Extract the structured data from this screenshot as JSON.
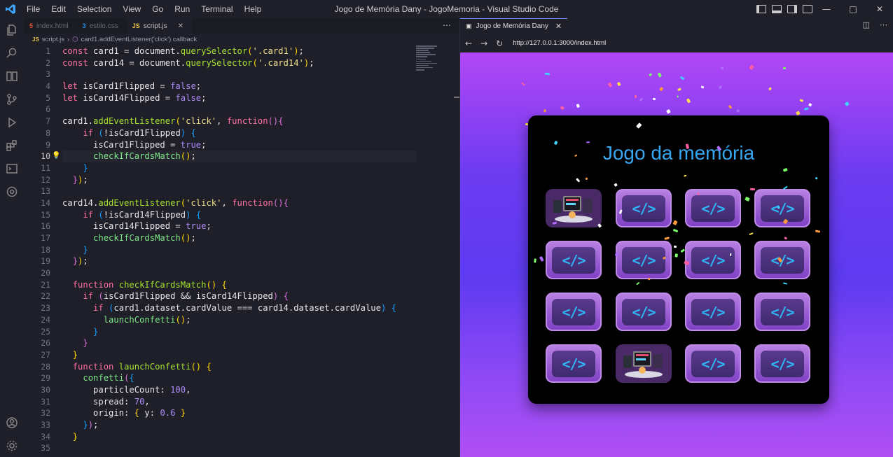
{
  "window": {
    "title": "Jogo de Memória Dany - JogoMemoria - Visual Studio Code",
    "menu": [
      "File",
      "Edit",
      "Selection",
      "View",
      "Go",
      "Run",
      "Terminal",
      "Help"
    ]
  },
  "editor": {
    "tabs": [
      {
        "label": "index.html",
        "icon": "5",
        "icon_color": "#e44d26",
        "active": false
      },
      {
        "label": "estilo.css",
        "icon": "3",
        "icon_color": "#2f8fe4",
        "active": false
      },
      {
        "label": "script.js",
        "icon": "JS",
        "icon_color": "#e6c54a",
        "active": true
      }
    ],
    "breadcrumb": {
      "file": "script.js",
      "file_icon": "JS",
      "symbol": "card1.addEventListener('click') callback"
    },
    "current_line": 10,
    "lightbulb_line": 10
  },
  "browser": {
    "tab_title": "Jogo de Memória Dany",
    "url": "http://127.0.0.1:3000/index.html",
    "game_title": "Jogo da memória",
    "card_symbol": "</>",
    "cards": [
      "flipped",
      "back",
      "back",
      "back",
      "back",
      "back",
      "back",
      "back",
      "back",
      "back",
      "back",
      "back",
      "back",
      "flipped",
      "back",
      "back"
    ]
  }
}
